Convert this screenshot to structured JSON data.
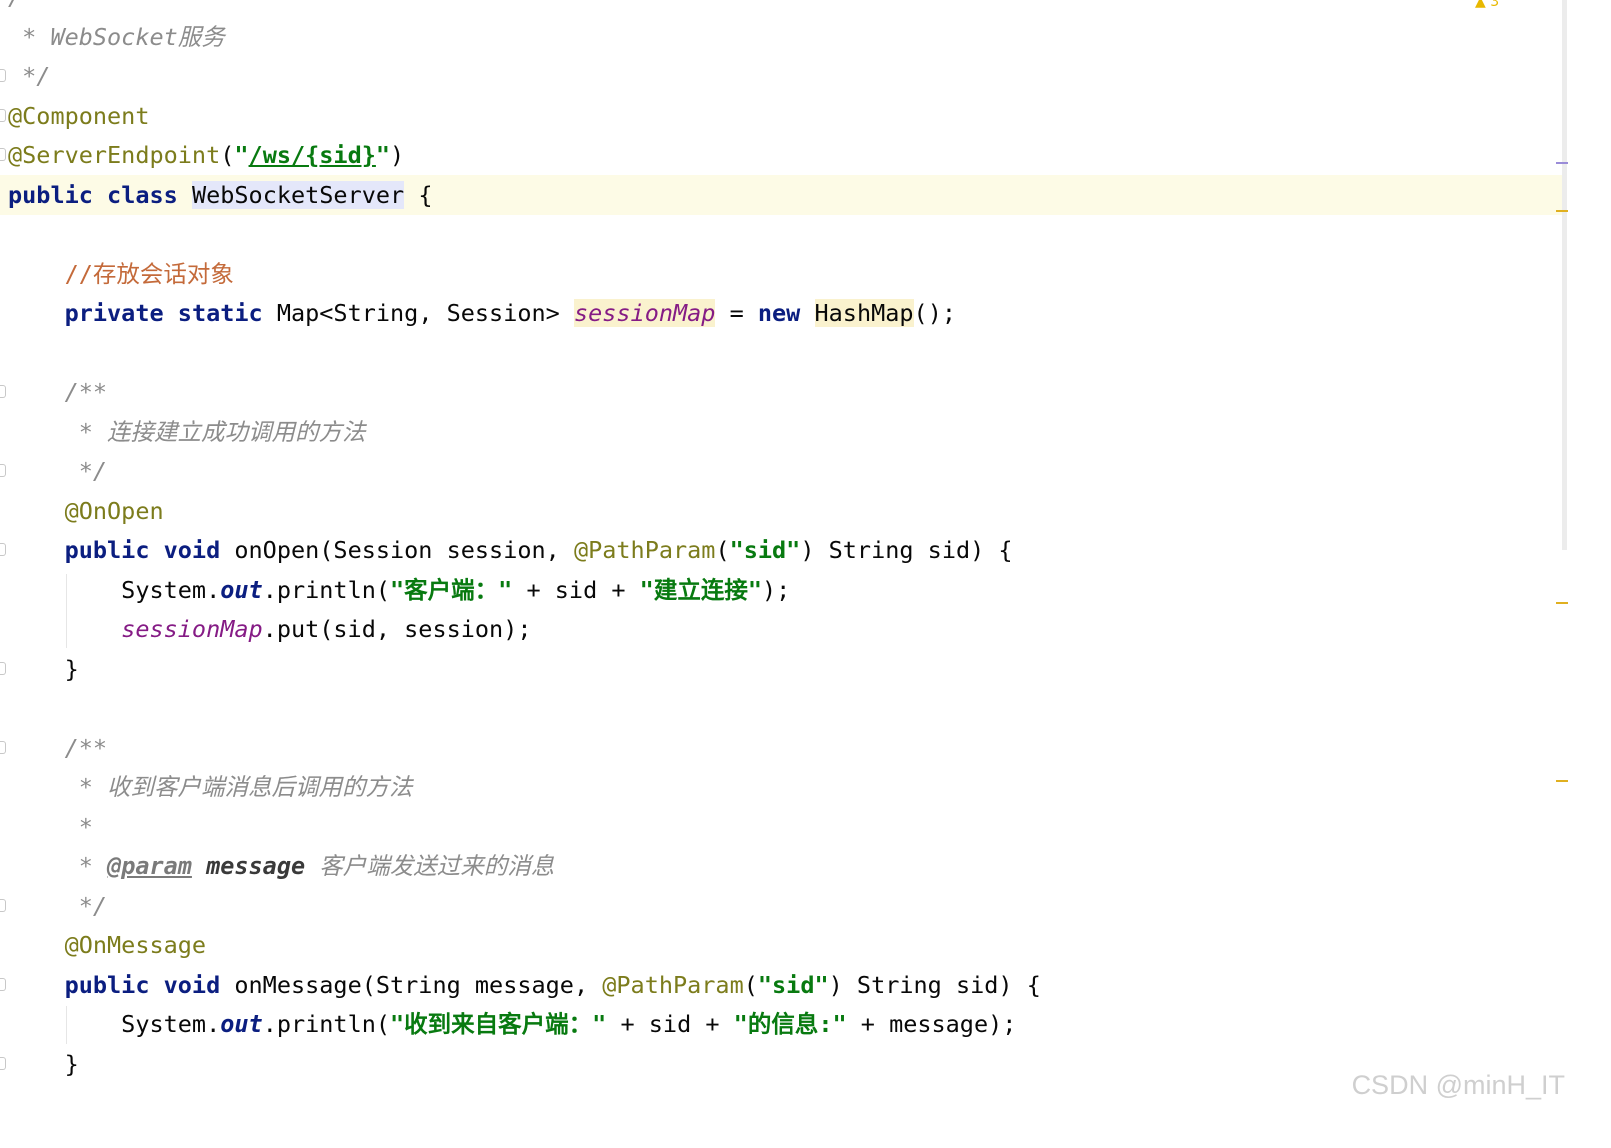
{
  "editor": {
    "lines": [
      {
        "parts": [
          {
            "t": "/**",
            "c": "cmt"
          }
        ]
      },
      {
        "parts": [
          {
            "t": " * WebSocket服务",
            "c": "cmt"
          }
        ]
      },
      {
        "parts": [
          {
            "t": " */",
            "c": "cmt"
          }
        ]
      },
      {
        "parts": [
          {
            "t": "@Component",
            "c": "ann"
          }
        ]
      },
      {
        "parts": [
          {
            "t": "@ServerEndpoint",
            "c": "ann"
          },
          {
            "t": "(",
            "c": ""
          },
          {
            "t": "\"",
            "c": "str"
          },
          {
            "t": "/ws/{sid}",
            "c": "str url"
          },
          {
            "t": "\"",
            "c": "str"
          },
          {
            "t": ")",
            "c": ""
          }
        ]
      },
      {
        "current": true,
        "parts": [
          {
            "t": "public",
            "c": "kw"
          },
          {
            "t": " ",
            "c": ""
          },
          {
            "t": "class",
            "c": "kw"
          },
          {
            "t": " ",
            "c": ""
          },
          {
            "t": "WebSocketServer",
            "c": "cls-hl"
          },
          {
            "t": " {",
            "c": ""
          }
        ]
      },
      {
        "parts": []
      },
      {
        "parts": [
          {
            "t": "    //存放会话对象",
            "c": "lcmt"
          }
        ]
      },
      {
        "parts": [
          {
            "t": "    ",
            "c": ""
          },
          {
            "t": "private",
            "c": "kw"
          },
          {
            "t": " ",
            "c": ""
          },
          {
            "t": "static",
            "c": "kw"
          },
          {
            "t": " Map<String, Session> ",
            "c": ""
          },
          {
            "t": "sessionMap",
            "c": "fld fld-hl"
          },
          {
            "t": " = ",
            "c": ""
          },
          {
            "t": "new",
            "c": "kw"
          },
          {
            "t": " ",
            "c": ""
          },
          {
            "t": "HashMap",
            "c": "new-hl"
          },
          {
            "t": "();",
            "c": ""
          }
        ]
      },
      {
        "parts": []
      },
      {
        "parts": [
          {
            "t": "    /**",
            "c": "cmt"
          }
        ]
      },
      {
        "parts": [
          {
            "t": "     * 连接建立成功调用的方法",
            "c": "cmt"
          }
        ]
      },
      {
        "parts": [
          {
            "t": "     */",
            "c": "cmt"
          }
        ]
      },
      {
        "parts": [
          {
            "t": "    ",
            "c": ""
          },
          {
            "t": "@OnOpen",
            "c": "ann"
          }
        ]
      },
      {
        "parts": [
          {
            "t": "    ",
            "c": ""
          },
          {
            "t": "public",
            "c": "kw"
          },
          {
            "t": " ",
            "c": ""
          },
          {
            "t": "void",
            "c": "kw"
          },
          {
            "t": " onOpen(Session session, ",
            "c": ""
          },
          {
            "t": "@PathParam",
            "c": "ann"
          },
          {
            "t": "(",
            "c": ""
          },
          {
            "t": "\"sid\"",
            "c": "str"
          },
          {
            "t": ") String sid) {",
            "c": ""
          }
        ]
      },
      {
        "parts": [
          {
            "t": "        System.",
            "c": ""
          },
          {
            "t": "out",
            "c": "kw fldref"
          },
          {
            "t": ".println(",
            "c": ""
          },
          {
            "t": "\"客户端：\"",
            "c": "str"
          },
          {
            "t": " + sid + ",
            "c": ""
          },
          {
            "t": "\"建立连接\"",
            "c": "str"
          },
          {
            "t": ");",
            "c": ""
          }
        ]
      },
      {
        "parts": [
          {
            "t": "        ",
            "c": ""
          },
          {
            "t": "sessionMap",
            "c": "fld"
          },
          {
            "t": ".put(sid, session);",
            "c": ""
          }
        ]
      },
      {
        "parts": [
          {
            "t": "    }",
            "c": ""
          }
        ]
      },
      {
        "parts": []
      },
      {
        "parts": [
          {
            "t": "    /**",
            "c": "cmt"
          }
        ]
      },
      {
        "parts": [
          {
            "t": "     * 收到客户端消息后调用的方法",
            "c": "cmt"
          }
        ]
      },
      {
        "parts": [
          {
            "t": "     *",
            "c": "cmt"
          }
        ]
      },
      {
        "parts": [
          {
            "t": "     * ",
            "c": "cmt"
          },
          {
            "t": "@param",
            "c": "doc-tag"
          },
          {
            "t": " ",
            "c": "cmt"
          },
          {
            "t": "message",
            "c": "doc-param"
          },
          {
            "t": " 客户端发送过来的消息",
            "c": "cmt"
          }
        ]
      },
      {
        "parts": [
          {
            "t": "     */",
            "c": "cmt"
          }
        ]
      },
      {
        "parts": [
          {
            "t": "    ",
            "c": ""
          },
          {
            "t": "@OnMessage",
            "c": "ann"
          }
        ]
      },
      {
        "parts": [
          {
            "t": "    ",
            "c": ""
          },
          {
            "t": "public",
            "c": "kw"
          },
          {
            "t": " ",
            "c": ""
          },
          {
            "t": "void",
            "c": "kw"
          },
          {
            "t": " onMessage(String message, ",
            "c": ""
          },
          {
            "t": "@PathParam",
            "c": "ann"
          },
          {
            "t": "(",
            "c": ""
          },
          {
            "t": "\"sid\"",
            "c": "str"
          },
          {
            "t": ") String sid) {",
            "c": ""
          }
        ]
      },
      {
        "parts": [
          {
            "t": "        System.",
            "c": ""
          },
          {
            "t": "out",
            "c": "kw fldref"
          },
          {
            "t": ".println(",
            "c": ""
          },
          {
            "t": "\"收到来自客户端：\"",
            "c": "str"
          },
          {
            "t": " + sid + ",
            "c": ""
          },
          {
            "t": "\"的信息:\"",
            "c": "str"
          },
          {
            "t": " + message);",
            "c": ""
          }
        ]
      },
      {
        "parts": [
          {
            "t": "    }",
            "c": ""
          }
        ]
      }
    ],
    "inspection_count": "3"
  },
  "watermark": "CSDN @minH_IT"
}
